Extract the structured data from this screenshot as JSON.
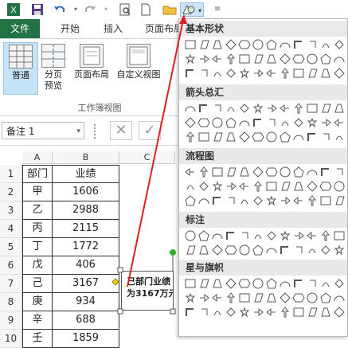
{
  "qat": {
    "save_icon": "save-icon",
    "undo_icon": "undo-icon",
    "redo_icon": "redo-icon"
  },
  "tabs": {
    "file": "文件",
    "home": "开始",
    "insert": "插入",
    "page_layout": "页面布局"
  },
  "ribbon": {
    "normal": "普通",
    "page_break_line1": "分页",
    "page_break_line2": "预览",
    "page_layout": "页面布局",
    "custom_view": "自定义视图",
    "group_label": "工作簿视图"
  },
  "formula_bar": {
    "name_box": "备注 1"
  },
  "columns": [
    "A",
    "B",
    "C"
  ],
  "rows": [
    {
      "n": "1",
      "a": "部门",
      "b": "业绩"
    },
    {
      "n": "2",
      "a": "甲",
      "b": "1606"
    },
    {
      "n": "3",
      "a": "乙",
      "b": "2988"
    },
    {
      "n": "4",
      "a": "丙",
      "b": "2115"
    },
    {
      "n": "5",
      "a": "丁",
      "b": "1772"
    },
    {
      "n": "6",
      "a": "戊",
      "b": "406"
    },
    {
      "n": "7",
      "a": "己",
      "b": "3167"
    },
    {
      "n": "8",
      "a": "庚",
      "b": "934"
    },
    {
      "n": "9",
      "a": "辛",
      "b": "688"
    },
    {
      "n": "10",
      "a": "壬",
      "b": "1859"
    }
  ],
  "callout": {
    "line1": "己部门业绩",
    "line2": "为3167万元"
  },
  "panel": {
    "basic_shapes": "基本形状",
    "block_arrows": "箭头总汇",
    "flowchart": "流程图",
    "callouts": "标注",
    "stars_banners": "星与旗帜"
  },
  "colors": {
    "excel_green": "#217346",
    "arrow_red": "#e02020",
    "handle_green": "#2fb02f"
  }
}
